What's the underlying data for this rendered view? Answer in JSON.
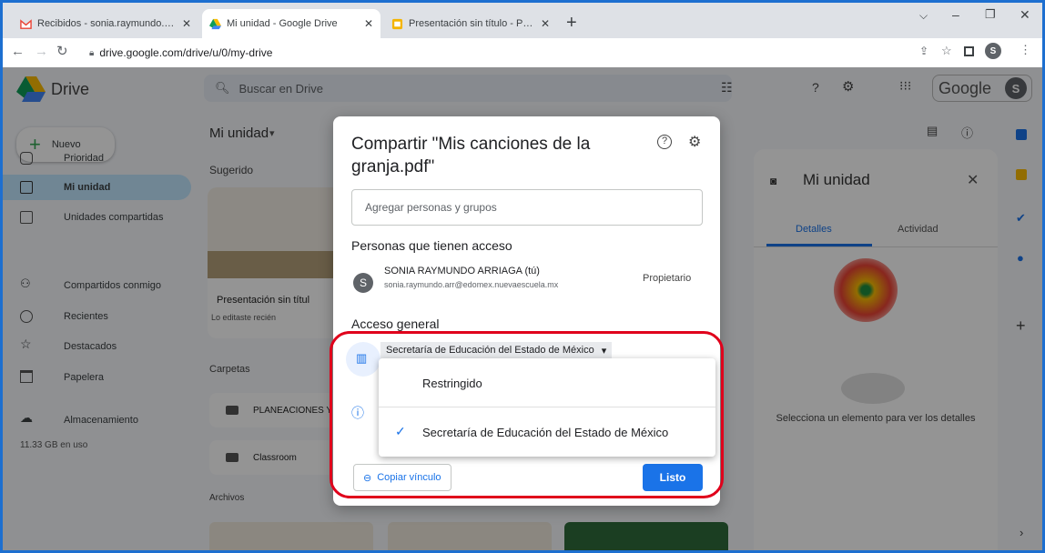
{
  "browser": {
    "tabs": [
      {
        "title": "Recibidos - sonia.raymundo.arr@",
        "active": false
      },
      {
        "title": "Mi unidad - Google Drive",
        "active": true
      },
      {
        "title": "Presentación sin título - Presenta",
        "active": false
      }
    ],
    "new_tab": "+",
    "url": "drive.google.com/drive/u/0/my-drive",
    "profile_initial": "S"
  },
  "drive": {
    "app_name": "Drive",
    "search_placeholder": "Buscar en Drive",
    "google_word": "Google",
    "avatar": "S",
    "new_button": "Nuevo",
    "nav": [
      {
        "label": "Prioridad",
        "icon": "check-circle-icon"
      },
      {
        "label": "Mi unidad",
        "icon": "my-drive-icon"
      },
      {
        "label": "Unidades compartidas",
        "icon": "shared-drives-icon"
      },
      {
        "label": "Compartidos conmigo",
        "icon": "people-icon"
      },
      {
        "label": "Recientes",
        "icon": "clock-icon"
      },
      {
        "label": "Destacados",
        "icon": "star-icon"
      },
      {
        "label": "Papelera",
        "icon": "trash-icon"
      },
      {
        "label": "Almacenamiento",
        "icon": "cloud-icon"
      }
    ],
    "storage_used": "11.33 GB en uso",
    "heading": "Mi unidad",
    "suggested_label": "Sugerido",
    "suggested_card_title": "Presentación sin títul",
    "suggested_card_sub": "Lo editaste recién",
    "folders_label": "Carpetas",
    "folders": [
      "PLANEACIONES Y",
      "Classroom"
    ],
    "files_label": "Archivos",
    "details_panel": {
      "title": "Mi unidad",
      "tab_details": "Detalles",
      "tab_activity": "Actividad",
      "empty_text": "Selecciona un elemento para ver los detalles"
    }
  },
  "dialog": {
    "title": "Compartir \"Mis canciones de la granja.pdf\"",
    "add_placeholder": "Agregar personas y grupos",
    "people_heading": "Personas que tienen acceso",
    "person": {
      "initial": "S",
      "name": "SONIA RAYMUNDO ARRIAGA (tú)",
      "email": "sonia.raymundo.arr@edomex.nuevaescuela.mx",
      "role": "Propietario"
    },
    "general_heading": "Acceso general",
    "access_selected": "Secretaría de Educación del Estado de México",
    "copy_link": "Copiar vínculo",
    "done": "Listo",
    "menu_options": [
      {
        "label": "Restringido",
        "selected": false
      },
      {
        "label": "Secretaría de Educación del Estado de México",
        "selected": true
      }
    ]
  },
  "colors": {
    "accent": "#1a73e8",
    "highlight_ring": "#e0001b",
    "frame": "#1d6fd0"
  }
}
